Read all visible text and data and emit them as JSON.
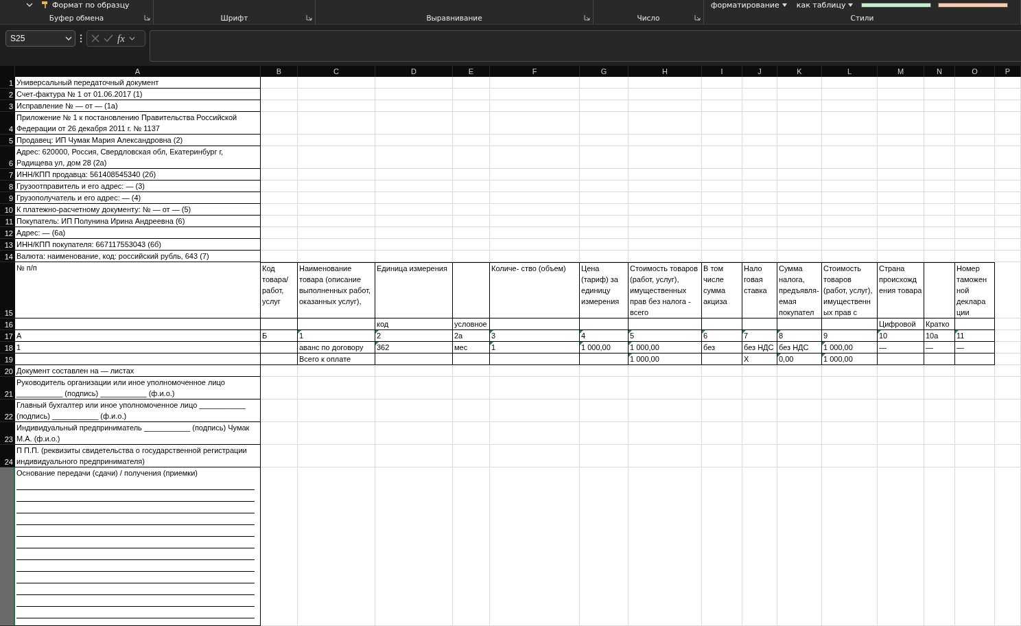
{
  "ribbon": {
    "format_painter": "Формат по образцу",
    "conditional_formatting": "форматирование",
    "format_as_table": "как таблицу",
    "swatches": [
      {
        "color": "#c6efce"
      },
      {
        "color": "#f8cbad"
      }
    ],
    "groups": [
      {
        "label": "Буфер обмена",
        "launcher": true
      },
      {
        "label": "Шрифт",
        "launcher": true
      },
      {
        "label": "Выравнивание",
        "launcher": true
      },
      {
        "label": "Число",
        "launcher": true
      },
      {
        "label": "Стили",
        "launcher": false
      }
    ]
  },
  "formula_bar": {
    "name_box": "S25",
    "function_label": "fx"
  },
  "sheet": {
    "columns": [
      "A",
      "B",
      "C",
      "D",
      "E",
      "F",
      "G",
      "H",
      "I",
      "J",
      "K",
      "L",
      "M",
      "N",
      "O",
      "P"
    ],
    "rows": [
      {
        "number": "1",
        "kind": "info",
        "selected": false,
        "cells": [
          {
            "text": "Универсальный передаточный документ"
          }
        ]
      },
      {
        "number": "2",
        "kind": "info",
        "selected": false,
        "cells": [
          {
            "text": "Счет-фактура № 1 от 01.06.2017 (1)"
          }
        ]
      },
      {
        "number": "3",
        "kind": "info",
        "selected": false,
        "cells": [
          {
            "text": "Исправление № — от — (1а)"
          }
        ]
      },
      {
        "number": "4",
        "kind": "info",
        "selected": false,
        "cells": [
          {
            "text": "Приложение № 1 к постановлению Правительства Российской Федерации от 26 декабря 2011 г. № 1137"
          }
        ]
      },
      {
        "number": "5",
        "kind": "info",
        "selected": false,
        "cells": [
          {
            "text": "Продавец: ИП Чумак Мария Александровна (2)"
          }
        ]
      },
      {
        "number": "6",
        "kind": "info",
        "selected": false,
        "cells": [
          {
            "text": "Адрес: 620000, Россия, Свердловская обл, Екатеринбург г, Радищева ул, дом 28 (2а)"
          }
        ]
      },
      {
        "number": "7",
        "kind": "info",
        "selected": false,
        "cells": [
          {
            "text": "ИНН/КПП продавца: 561408545340 (2б)"
          }
        ]
      },
      {
        "number": "8",
        "kind": "info",
        "selected": false,
        "cells": [
          {
            "text": "Грузоотправитель и его адрес: — (3)"
          }
        ]
      },
      {
        "number": "9",
        "kind": "info",
        "selected": false,
        "cells": [
          {
            "text": "Грузополучатель и его адрес: — (4)"
          }
        ]
      },
      {
        "number": "10",
        "kind": "info",
        "selected": false,
        "cells": [
          {
            "text": "К платежно-расчетному документу: № — от — (5)"
          }
        ]
      },
      {
        "number": "11",
        "kind": "info",
        "selected": false,
        "cells": [
          {
            "text": "Покупатель: ИП Полунина Ирина Андреевна (6)"
          }
        ]
      },
      {
        "number": "12",
        "kind": "info",
        "selected": false,
        "cells": [
          {
            "text": "Адрес: — (6а)"
          }
        ]
      },
      {
        "number": "13",
        "kind": "info",
        "selected": false,
        "cells": [
          {
            "text": "ИНН/КПП покупателя: 667117553043 (6б)"
          }
        ]
      },
      {
        "number": "14",
        "kind": "info",
        "selected": false,
        "cells": [
          {
            "text": "Валюта: наименование, код: российский рубль, 643 (7)"
          }
        ]
      },
      {
        "number": "15",
        "kind": "table",
        "selected": false,
        "cells": [
          {
            "text": "№ п/п",
            "warn": false
          },
          {
            "text": "Код товара/ работ, услуг",
            "warn": false
          },
          {
            "text": "Наименование товара (описание выполненных работ, оказанных услуг),",
            "warn": false
          },
          {
            "text": "Единица измерения",
            "warn": false
          },
          {
            "warn": false
          },
          {
            "text": "Количе- ство (объем)",
            "warn": false
          },
          {
            "text": "Цена (тариф) за единицу измерения",
            "warn": false
          },
          {
            "text": "Стоимость товаров (работ, услуг), имущественных прав без налога - всего",
            "warn": false
          },
          {
            "text": "В том числе сумма акциза",
            "warn": false
          },
          {
            "text": "Нало говая ставка",
            "warn": false
          },
          {
            "text": "Сумма налога, предъявля- емая покупател",
            "warn": false
          },
          {
            "text": "Стоимость товаров (работ, услуг), имущественн ых прав с",
            "warn": false
          },
          {
            "text": "Страна происхожд ения товара",
            "warn": false
          },
          {
            "warn": false
          },
          {
            "text": "Номер таможен ной деклара ции",
            "warn": false
          }
        ]
      },
      {
        "number": "16",
        "kind": "table",
        "selected": false,
        "cells": [
          {
            "warn": false
          },
          {
            "warn": false
          },
          {
            "warn": false
          },
          {
            "text": "код",
            "warn": false
          },
          {
            "text": "условное",
            "warn": false
          },
          {
            "warn": false
          },
          {
            "warn": false
          },
          {
            "warn": false
          },
          {
            "warn": false
          },
          {
            "warn": false
          },
          {
            "warn": false
          },
          {
            "warn": false
          },
          {
            "text": "Цифровой",
            "warn": false
          },
          {
            "text": "Кратко",
            "warn": false
          },
          {
            "warn": false
          }
        ]
      },
      {
        "number": "17",
        "kind": "table",
        "selected": false,
        "cells": [
          {
            "text": "А",
            "warn": false
          },
          {
            "text": "Б",
            "warn": false
          },
          {
            "text": "1",
            "warn": true
          },
          {
            "text": "2",
            "warn": true
          },
          {
            "text": "2а",
            "warn": false
          },
          {
            "text": "3",
            "warn": true
          },
          {
            "text": "4",
            "warn": true
          },
          {
            "text": "5",
            "warn": true
          },
          {
            "text": "6",
            "warn": true
          },
          {
            "text": "7",
            "warn": true
          },
          {
            "text": "8",
            "warn": true
          },
          {
            "text": "9",
            "warn": false
          },
          {
            "text": "10",
            "warn": true
          },
          {
            "text": "10а",
            "warn": false
          },
          {
            "text": "11",
            "warn": true
          }
        ]
      },
      {
        "number": "18",
        "kind": "table",
        "selected": false,
        "cells": [
          {
            "text": "1",
            "warn": false
          },
          {
            "warn": false
          },
          {
            "text": "аванс по договору",
            "warn": false
          },
          {
            "text": "362",
            "warn": true
          },
          {
            "text": "мес",
            "warn": false
          },
          {
            "text": "1",
            "warn": true
          },
          {
            "text": "1 000,00",
            "warn": true
          },
          {
            "text": "1 000,00",
            "warn": true
          },
          {
            "text": "без",
            "warn": false
          },
          {
            "text": "без НДС",
            "warn": false
          },
          {
            "text": "без НДС",
            "warn": false
          },
          {
            "text": "1 000,00",
            "warn": true
          },
          {
            "text": "—",
            "warn": false
          },
          {
            "text": "—",
            "warn": false
          },
          {
            "text": "—",
            "warn": false
          }
        ]
      },
      {
        "number": "19",
        "kind": "table",
        "selected": false,
        "cells": [
          {
            "warn": false
          },
          {
            "warn": false
          },
          {
            "text": "Всего к оплате",
            "warn": false
          },
          {
            "warn": false
          },
          {
            "warn": false
          },
          {
            "warn": false
          },
          {
            "warn": false
          },
          {
            "text": "1 000,00",
            "warn": true
          },
          {
            "warn": false
          },
          {
            "text": "Х",
            "warn": false
          },
          {
            "text": "0,00",
            "warn": true
          },
          {
            "text": "1 000,00",
            "warn": true
          },
          {
            "warn": false
          },
          {
            "warn": false
          },
          {
            "warn": false
          }
        ]
      },
      {
        "number": "20",
        "kind": "info",
        "selected": false,
        "cells": [
          {
            "text": "Документ составлен на — листах"
          }
        ]
      },
      {
        "number": "21",
        "kind": "info",
        "selected": false,
        "cells": [
          {
            "text": "Руководитель организации или иное уполномоченное лицо ___________ (подпись) ___________ (ф.и.о.)"
          }
        ]
      },
      {
        "number": "22",
        "kind": "info",
        "selected": false,
        "cells": [
          {
            "text": "Главный бухгалтер или иное уполномоченное лицо ___________ (подпись) ___________ (ф.и.о.)"
          }
        ]
      },
      {
        "number": "23",
        "kind": "info",
        "selected": false,
        "cells": [
          {
            "text": "Индивидуальный предприниматель ___________ (подпись) Чумак М.А. (ф.и.о.)"
          }
        ]
      },
      {
        "number": "24",
        "kind": "info",
        "selected": false,
        "cells": [
          {
            "text": "П П.П. (реквизиты свидетельства о государственной регистрации индивидуального предпринимателя)"
          }
        ]
      },
      {
        "kind": "lined",
        "selected": true,
        "cells": [
          {
            "text": "Основание передачи (сдачи) / получения (приемки)"
          }
        ]
      }
    ]
  }
}
